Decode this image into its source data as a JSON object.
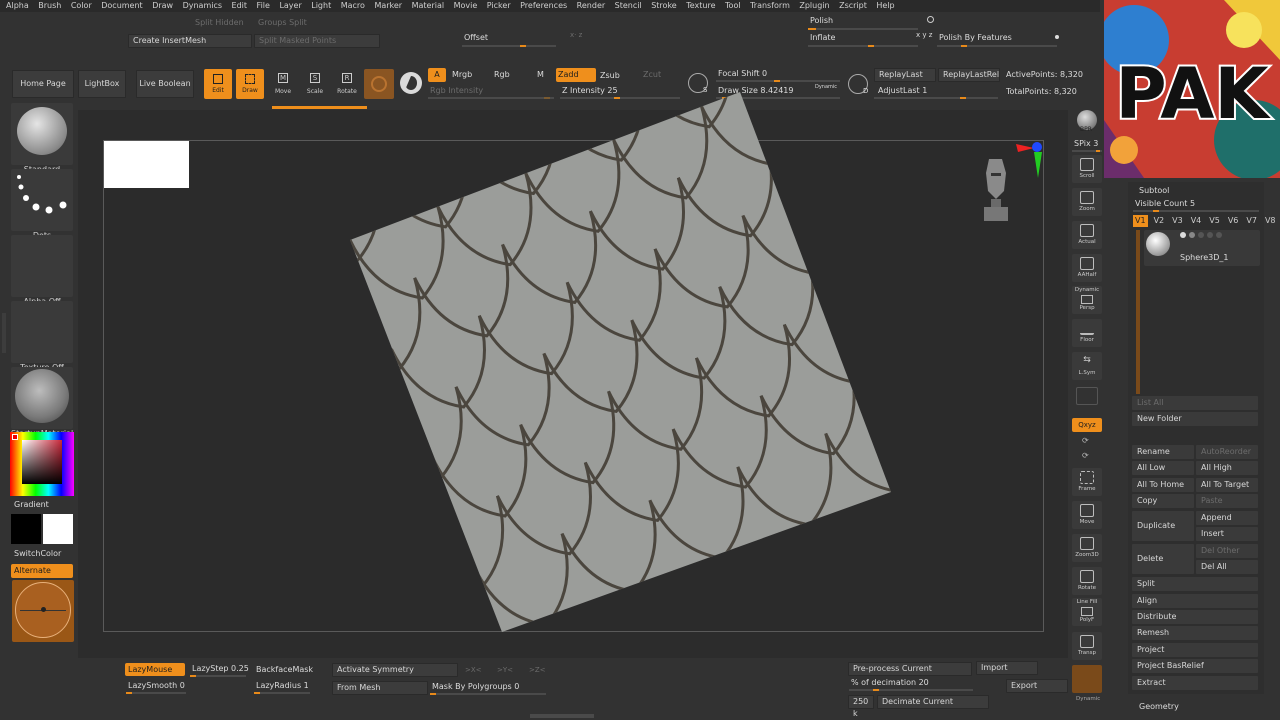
{
  "menu": [
    "Alpha",
    "Brush",
    "Color",
    "Document",
    "Draw",
    "Dynamics",
    "Edit",
    "File",
    "Layer",
    "Light",
    "Macro",
    "Marker",
    "Material",
    "Movie",
    "Picker",
    "Preferences",
    "Render",
    "Stencil",
    "Stroke",
    "Texture",
    "Tool",
    "Transform",
    "Zplugin",
    "Zscript",
    "Help"
  ],
  "top": {
    "split_hidden": "Split Hidden",
    "groups_split": "Groups Split",
    "create_insert": "Create InsertMesh",
    "split_masked": "Split Masked Points",
    "offset": "Offset",
    "offset_xyz": "x· z",
    "polish": "Polish",
    "inflate": "Inflate",
    "inflate_xyz": "x y z",
    "polish_features": "Polish By Features"
  },
  "toolbar": {
    "home": "Home Page",
    "lightbox": "LightBox",
    "live_boolean": "Live Boolean",
    "edit": "Edit",
    "draw": "Draw",
    "move": "Move",
    "scale": "Scale",
    "rotate": "Rotate",
    "a": "A",
    "mrgb": "Mrgb",
    "rgb": "Rgb",
    "m": "M",
    "zadd": "Zadd",
    "zsub": "Zsub",
    "zcut": "Zcut",
    "rgb_intensity": "Rgb Intensity",
    "z_intensity": "Z Intensity 25",
    "focal_shift": "Focal Shift 0",
    "draw_size": "Draw Size 8.42419",
    "dynamic": "Dynamic",
    "replay_last": "ReplayLast",
    "replay_last_rel": "ReplayLastRel",
    "adjust_last": "AdjustLast 1",
    "active_points": "ActivePoints: 8,320",
    "total_points": "TotalPoints: 8,320",
    "s_label": "S",
    "d_label": "D"
  },
  "left": {
    "standard": "Standard",
    "dots": "Dots",
    "alpha_off": "Alpha Off",
    "texture_off": "Texture Off",
    "startup_material": "StartupMaterial",
    "gradient": "Gradient",
    "switch_color": "SwitchColor",
    "alternate": "Alternate"
  },
  "right_shelf": {
    "bpr": "BPR",
    "spix": "SPix 3",
    "scroll": "Scroll",
    "zoom": "Zoom",
    "actual": "Actual",
    "aahalf": "AAHalf",
    "dynamic": "Dynamic",
    "persp": "Persp",
    "floor": "Floor",
    "lsym": "L.Sym",
    "xyz": "Qxyz",
    "frame": "Frame",
    "move": "Move",
    "zoom3d": "Zoom3D",
    "rotate": "Rotate",
    "line_fill": "Line Fill",
    "polyf": "PolyF",
    "transp": "Transp",
    "dynamic2": "Dynamic"
  },
  "subtool": {
    "title": "Subtool",
    "visible_count": "Visible Count 5",
    "versions": [
      "V1",
      "V2",
      "V3",
      "V4",
      "V5",
      "V6",
      "V7",
      "V8"
    ],
    "item_name": "Sphere3D_1",
    "list_all": "List All",
    "new_folder": "New Folder",
    "rename": "Rename",
    "auto_reorder": "AutoReorder",
    "all_low": "All Low",
    "all_high": "All High",
    "all_to_home": "All To Home",
    "all_to_target": "All To Target",
    "copy": "Copy",
    "paste": "Paste",
    "duplicate": "Duplicate",
    "append": "Append",
    "insert": "Insert",
    "delete": "Delete",
    "del_other": "Del Other",
    "del_all": "Del All",
    "split": "Split",
    "align": "Align",
    "distribute": "Distribute",
    "remesh": "Remesh",
    "project": "Project",
    "project_basrelief": "Project BasRelief",
    "extract": "Extract",
    "geometry": "Geometry"
  },
  "bottom": {
    "lazymouse": "LazyMouse",
    "lazystep": "LazyStep 0.25",
    "backfacemask": "BackfaceMask",
    "activate_symmetry": "Activate Symmetry",
    "x": ">X<",
    "y": ">Y<",
    "z": ">Z<",
    "lazysmooth": "LazySmooth 0",
    "lazyradius": "LazyRadius 1",
    "from_mesh": "From Mesh",
    "mask_polygroups": "Mask By Polygroups 0",
    "preprocess": "Pre-process Current",
    "import": "Import",
    "decimation": "% of decimation 20",
    "export": "Export",
    "k250": "250 k",
    "decimate_current": "Decimate Current"
  },
  "logo_text": "PAK",
  "colors": {
    "accent": "#ef8f1c",
    "bg": "#323232",
    "canvas": "#2b2b2b",
    "mesh": "#9b9d9a"
  }
}
